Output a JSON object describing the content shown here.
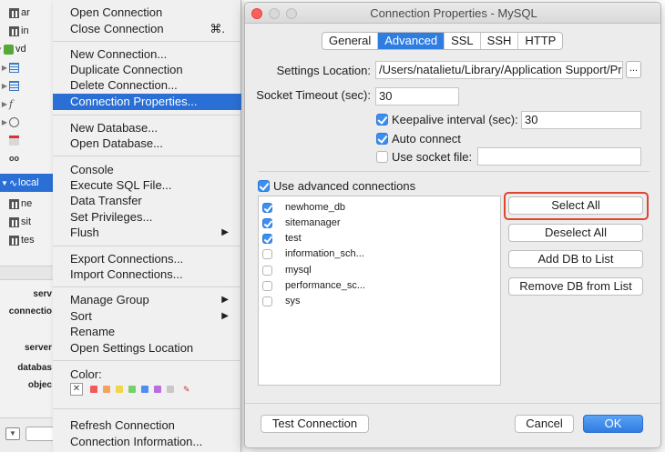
{
  "tree": {
    "items": [
      {
        "label": "ar",
        "icon": "table-icon"
      },
      {
        "label": "in",
        "icon": "table-icon"
      },
      {
        "label": "vd",
        "icon": "database-icon"
      },
      {
        "label": "",
        "icon": "grid-icon"
      },
      {
        "label": "",
        "icon": "view-icon"
      },
      {
        "label": "",
        "icon": "function-icon"
      },
      {
        "label": "",
        "icon": "clock-icon"
      },
      {
        "label": "",
        "icon": "calendar-icon"
      },
      {
        "label": "",
        "icon": "query-icon"
      },
      {
        "label": "local",
        "icon": "connection-icon"
      },
      {
        "label": "ne",
        "icon": "table-icon"
      },
      {
        "label": "sit",
        "icon": "table-icon"
      },
      {
        "label": "tes",
        "icon": "table-icon"
      }
    ],
    "props": [
      "serv",
      "connectio",
      "server",
      "databas",
      "objec"
    ]
  },
  "menu": {
    "items": [
      {
        "label": "Open Connection"
      },
      {
        "label": "Close Connection",
        "shortcut": "⌘."
      },
      {
        "label": "New Connection..."
      },
      {
        "label": "Duplicate Connection"
      },
      {
        "label": "Delete Connection..."
      },
      {
        "label": "Connection Properties..."
      },
      {
        "label": "New Database..."
      },
      {
        "label": "Open Database..."
      },
      {
        "label": "Console"
      },
      {
        "label": "Execute SQL File..."
      },
      {
        "label": "Data Transfer"
      },
      {
        "label": "Set Privileges..."
      },
      {
        "label": "Flush"
      },
      {
        "label": "Export Connections..."
      },
      {
        "label": "Import Connections..."
      },
      {
        "label": "Manage Group"
      },
      {
        "label": "Sort"
      },
      {
        "label": "Rename"
      },
      {
        "label": "Open Settings Location"
      },
      {
        "label": "Color:"
      },
      {
        "label": "Refresh Connection"
      },
      {
        "label": "Connection Information..."
      }
    ],
    "highlighted_item": "Connection Properties...",
    "color_swatches": [
      "#ffffff",
      "#f05a5a",
      "#f5a25a",
      "#f2d64a",
      "#78d06a",
      "#4f8ef0",
      "#b86ee0",
      "#c8c8c8"
    ]
  },
  "dialog": {
    "title": "Connection Properties - MySQL",
    "tabs": [
      "General",
      "Advanced",
      "SSL",
      "SSH",
      "HTTP"
    ],
    "active_tab": "Advanced",
    "settings_location_label": "Settings Location:",
    "settings_location_value": "/Users/natalietu/Library/Application Support/Pr",
    "browse_label": "...",
    "socket_timeout_label": "Socket Timeout (sec):",
    "socket_timeout_value": "30",
    "keepalive_label": "Keepalive interval (sec):",
    "keepalive_checked": true,
    "keepalive_value": "30",
    "auto_connect_label": "Auto connect",
    "auto_connect_checked": true,
    "use_socket_label": "Use socket file:",
    "use_socket_checked": false,
    "socket_file_value": "",
    "advanced_connections_label": "Use advanced connections",
    "advanced_connections_checked": true,
    "databases": [
      {
        "name": "newhome_db",
        "checked": true
      },
      {
        "name": "sitemanager",
        "checked": true
      },
      {
        "name": "test",
        "checked": true
      },
      {
        "name": "information_sch...",
        "checked": false
      },
      {
        "name": "mysql",
        "checked": false
      },
      {
        "name": "performance_sc...",
        "checked": false
      },
      {
        "name": "sys",
        "checked": false
      }
    ],
    "select_all": "Select All",
    "deselect_all": "Deselect All",
    "add_db": "Add DB to List",
    "remove_db": "Remove DB from List",
    "test_connection": "Test Connection",
    "cancel": "Cancel",
    "ok": "OK",
    "accent_color": "#2f7de1",
    "highlight_color": "#e0452f"
  }
}
